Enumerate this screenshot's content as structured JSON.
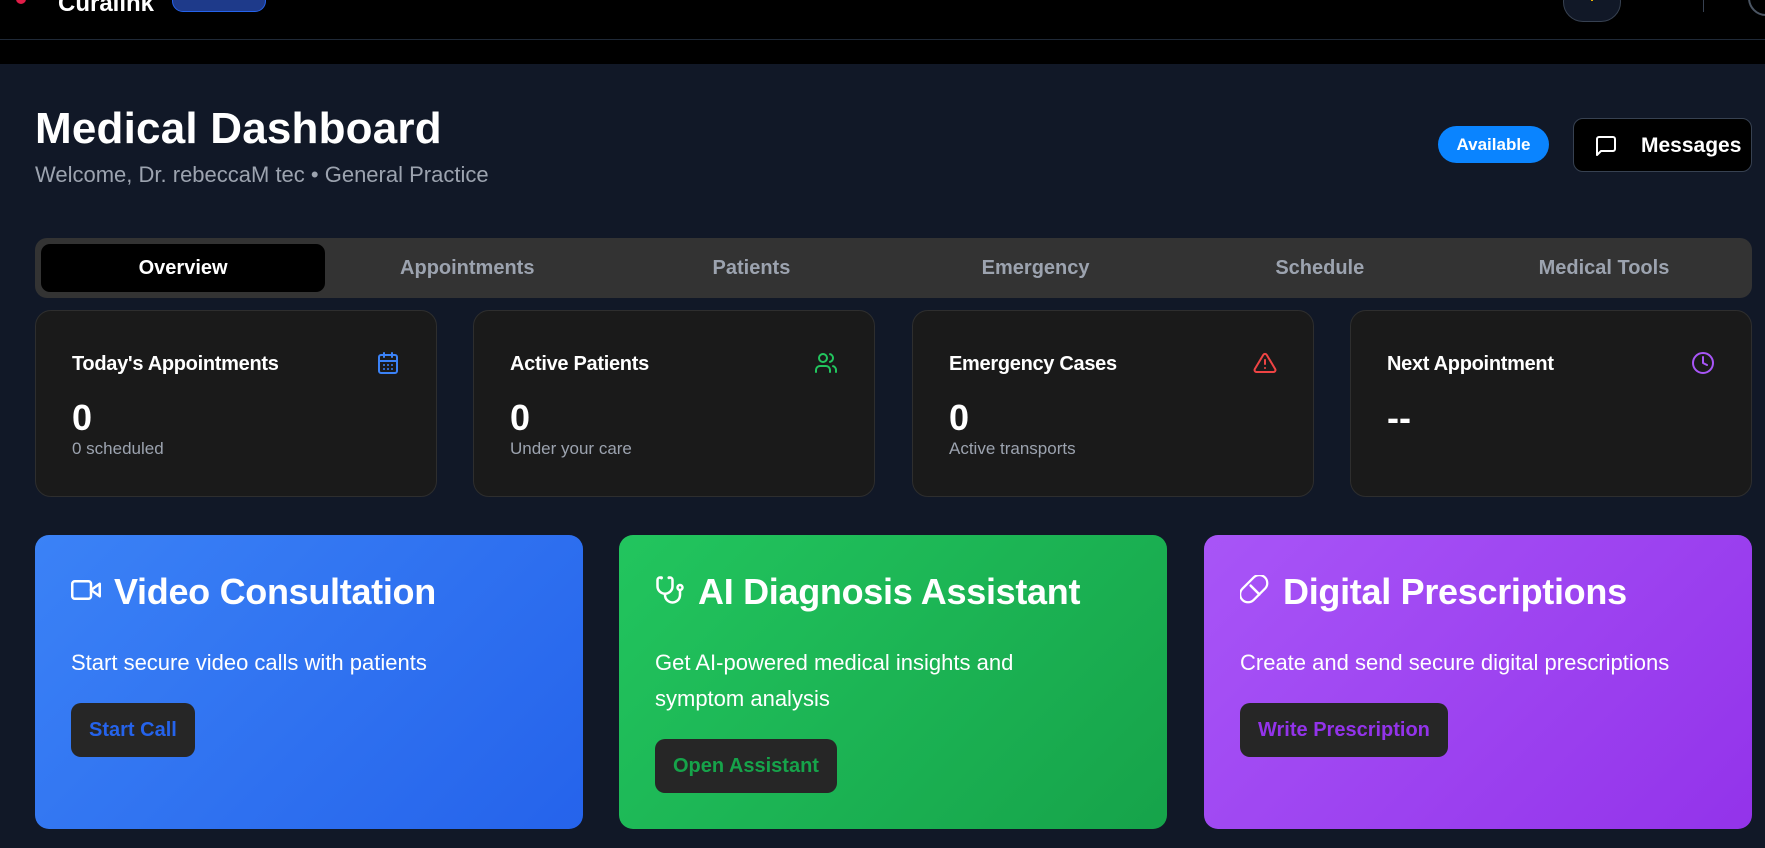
{
  "topnav": {
    "brand": "Curalink"
  },
  "header": {
    "title": "Medical Dashboard",
    "subtitle": "Welcome, Dr. rebeccaM tec • General Practice",
    "status_badge": "Available",
    "messages_label": "Messages"
  },
  "tabs": [
    {
      "label": "Overview",
      "active": true
    },
    {
      "label": "Appointments",
      "active": false
    },
    {
      "label": "Patients",
      "active": false
    },
    {
      "label": "Emergency",
      "active": false
    },
    {
      "label": "Schedule",
      "active": false
    },
    {
      "label": "Medical Tools",
      "active": false
    }
  ],
  "stats": [
    {
      "title": "Today's Appointments",
      "value": "0",
      "sub": "0 scheduled",
      "icon": "calendar-icon",
      "color": "#3b82f6"
    },
    {
      "title": "Active Patients",
      "value": "0",
      "sub": "Under your care",
      "icon": "users-icon",
      "color": "#22c55e"
    },
    {
      "title": "Emergency Cases",
      "value": "0",
      "sub": "Active transports",
      "icon": "alert-triangle-icon",
      "color": "#ef4444"
    },
    {
      "title": "Next Appointment",
      "value": "--",
      "sub": "",
      "icon": "clock-icon",
      "color": "#a855f7"
    }
  ],
  "features": [
    {
      "title": "Video Consultation",
      "desc": "Start secure video calls with patients",
      "button": "Start Call",
      "icon": "video-icon",
      "button_color": "#2563eb"
    },
    {
      "title": "AI Diagnosis Assistant",
      "desc": "Get AI-powered medical insights and symptom analysis",
      "button": "Open Assistant",
      "icon": "stethoscope-icon",
      "button_color": "#16a34a"
    },
    {
      "title": "Digital Prescriptions",
      "desc": "Create and send secure digital prescriptions",
      "button": "Write Prescription",
      "icon": "pill-icon",
      "button_color": "#9333ea"
    }
  ]
}
